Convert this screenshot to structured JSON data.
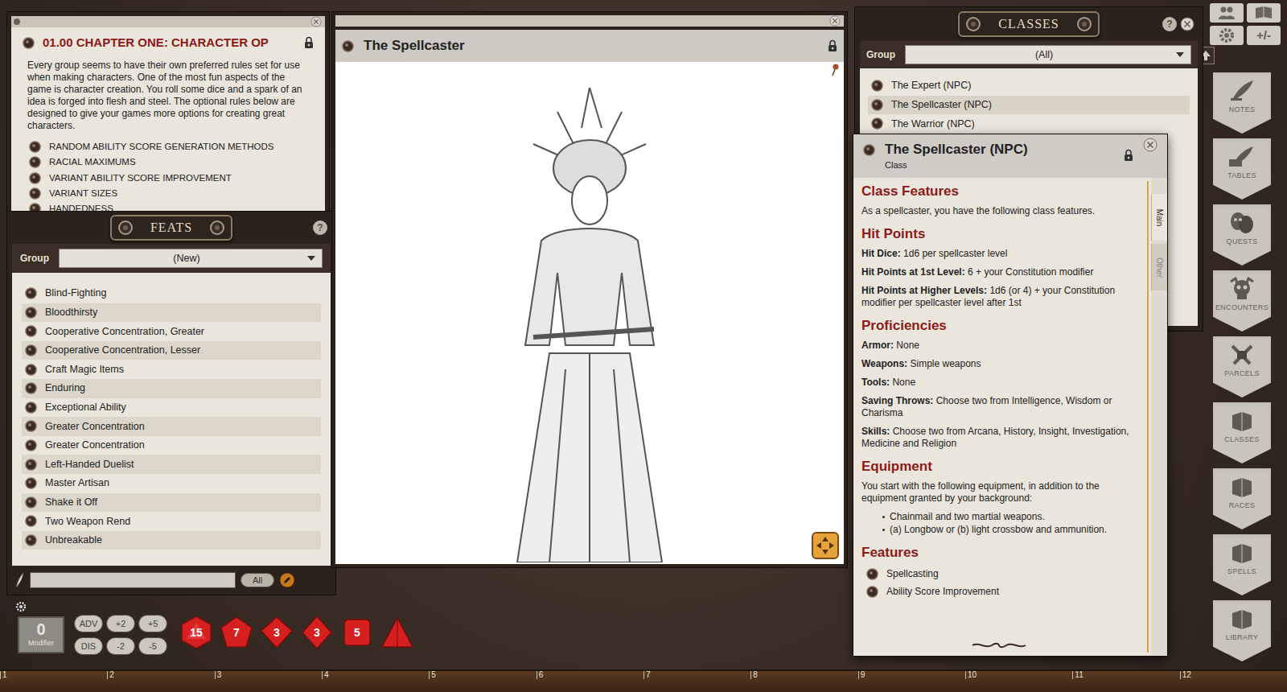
{
  "chapter": {
    "title": "01.00 CHAPTER ONE: CHARACTER OP",
    "body": "Every group seems to have their own preferred rules set for use when making characters. One of the most fun aspects of the game is character creation. You roll some dice and a spark of an idea is forged into flesh and steel. The optional rules below are designed to give your games more options for creating great characters.",
    "items": [
      "RANDOM ABILITY SCORE GENERATION METHODS",
      "RACIAL MAXIMUMS",
      "VARIANT ABILITY SCORE IMPROVEMENT",
      "VARIANT SIZES",
      "HANDEDNESS"
    ]
  },
  "feats": {
    "title": "FEATS",
    "help": "?",
    "group_label": "Group",
    "group_value": "(New)",
    "items": [
      "Blind-Fighting",
      "Bloodthirsty",
      "Cooperative Concentration, Greater",
      "Cooperative Concentration, Lesser",
      "Craft Magic Items",
      "Enduring",
      "Exceptional Ability",
      "Greater Concentration",
      "Greater Concentration",
      "Left-Handed Duelist",
      "Master Artisan",
      "Shake it Off",
      "Two Weapon Rend",
      "Unbreakable"
    ],
    "filter_button": "All"
  },
  "image_window": {
    "title": "The Spellcaster"
  },
  "classes": {
    "title": "CLASSES",
    "help": "?",
    "group_label": "Group",
    "group_value": "(All)",
    "items": [
      {
        "label": "The Expert (NPC)",
        "selected": false
      },
      {
        "label": "The Spellcaster (NPC)",
        "selected": true
      },
      {
        "label": "The Warrior (NPC)",
        "selected": false
      }
    ]
  },
  "class_record": {
    "title": "The Spellcaster (NPC)",
    "subtitle": "Class",
    "tabs": [
      {
        "label": "Main",
        "selected": true
      },
      {
        "label": "Other",
        "selected": false
      }
    ],
    "sections": [
      {
        "heading": "Class Features",
        "entries": [
          {
            "kind": "para",
            "text": "As a spellcaster, you have the following class features."
          }
        ]
      },
      {
        "heading": "Hit Points",
        "entries": [
          {
            "kind": "field",
            "label": "Hit Dice:",
            "value": "1d6 per spellcaster level"
          },
          {
            "kind": "field",
            "label": "Hit Points at 1st Level:",
            "value": "6 + your Constitution modifier"
          },
          {
            "kind": "field",
            "label": "Hit Points at Higher Levels:",
            "value": "1d6 (or 4) + your Constitution modifier per spellcaster level after 1st"
          }
        ]
      },
      {
        "heading": "Proficiencies",
        "entries": [
          {
            "kind": "field",
            "label": "Armor:",
            "value": "None"
          },
          {
            "kind": "field",
            "label": "Weapons:",
            "value": "Simple weapons"
          },
          {
            "kind": "field",
            "label": "Tools:",
            "value": "None"
          },
          {
            "kind": "field",
            "label": "Saving Throws:",
            "value": "Choose two from Intelligence, Wisdom or Charisma"
          },
          {
            "kind": "field",
            "label": "Skills:",
            "value": "Choose two from Arcana, History, Insight, Investigation, Medicine and Religion"
          }
        ]
      },
      {
        "heading": "Equipment",
        "entries": [
          {
            "kind": "para",
            "text": "You start with the following equipment, in addition to the equipment granted by your background:"
          },
          {
            "kind": "bullets",
            "items": [
              "Chainmail and two martial weapons.",
              "(a) Longbow or (b) light crossbow and ammunition."
            ]
          }
        ]
      },
      {
        "heading": "Features",
        "entries": [
          {
            "kind": "links",
            "items": [
              "Spellcasting",
              "Ability Score Improvement"
            ]
          }
        ]
      }
    ]
  },
  "sidebar": {
    "toggle": "+/-",
    "buttons": [
      "NOTES",
      "TABLES",
      "QUESTS",
      "ENCOUNTERS",
      "PARCELS",
      "CLASSES",
      "RACES",
      "SPELLS",
      "LIBRARY"
    ]
  },
  "dice_tray": {
    "modifier": "0",
    "modifier_label": "Modifier",
    "buttons": [
      "ADV",
      "+2",
      "+5",
      "DIS",
      "-2",
      "-5"
    ],
    "dice": [
      {
        "kind": "d20",
        "face": "15"
      },
      {
        "kind": "d12",
        "face": "7"
      },
      {
        "kind": "d10",
        "face": "3"
      },
      {
        "kind": "d8",
        "face": "3"
      },
      {
        "kind": "d6",
        "face": "5"
      },
      {
        "kind": "d4"
      }
    ]
  },
  "ruler": [
    "1",
    "2",
    "3",
    "4",
    "5",
    "6",
    "7",
    "8",
    "9",
    "10",
    "11",
    "12"
  ]
}
